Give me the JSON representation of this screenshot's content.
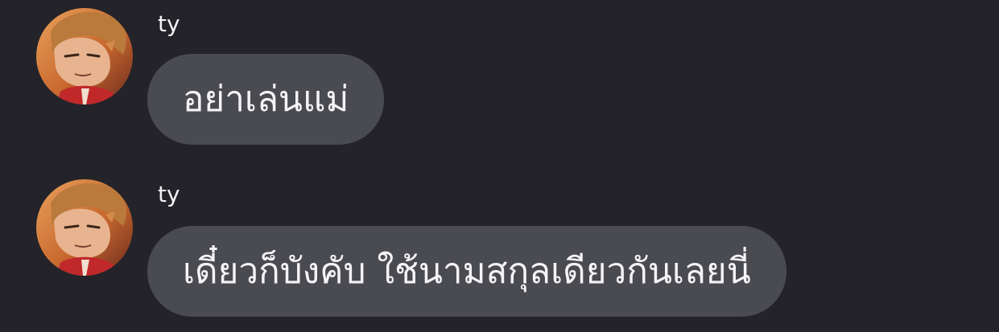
{
  "messages": [
    {
      "sender": "ty",
      "text": "อย่าเล่นแม่",
      "avatar_icon": "user-avatar-icon"
    },
    {
      "sender": "ty",
      "text": "เดี๋ยวก็บังคับ ใช้นามสกุลเดียวกันเลยนี่",
      "avatar_icon": "user-avatar-icon"
    }
  ],
  "colors": {
    "background": "#232329",
    "bubble": "#4a4a51",
    "text": "#f4f4f6"
  }
}
